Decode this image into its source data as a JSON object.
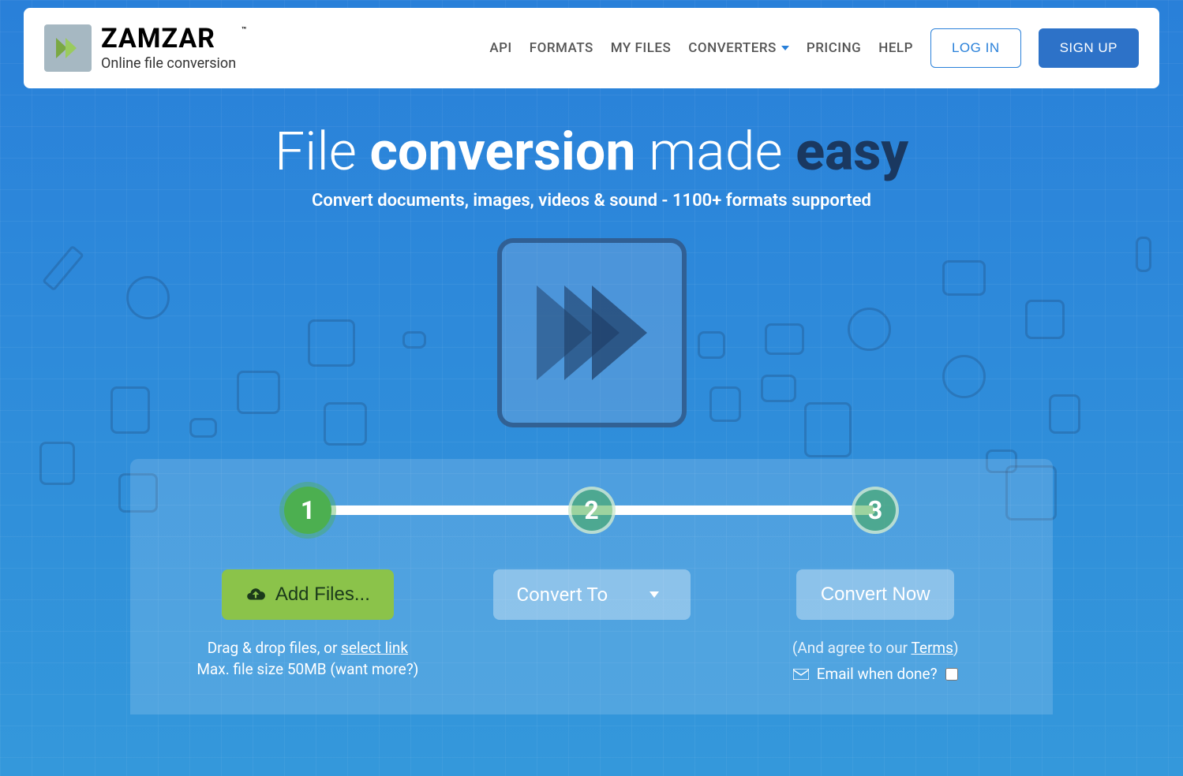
{
  "brand": {
    "name": "ZAMZAR",
    "tagline": "Online file conversion",
    "tm": "™"
  },
  "nav": {
    "api": "API",
    "formats": "FORMATS",
    "myfiles": "MY FILES",
    "converters": "CONVERTERS",
    "pricing": "PRICING",
    "help": "HELP",
    "login": "LOG IN",
    "signup": "SIGN UP"
  },
  "hero": {
    "t1": "File ",
    "t2": "conversion",
    "t3": " made ",
    "t4": "easy",
    "subtitle": "Convert documents, images, videos & sound - 1100+ formats supported"
  },
  "steps": {
    "s1": "1",
    "s2": "2",
    "s3": "3"
  },
  "panel": {
    "add_files": "Add Files...",
    "drag_prefix": "Drag & drop files, or ",
    "drag_link": "select link",
    "max_prefix": "Max. file size 50MB (",
    "max_link": "want more?",
    "max_suffix": ")",
    "convert_to": "Convert To",
    "convert_now": "Convert Now",
    "agree_prefix": "(And agree to our ",
    "agree_link": "Terms",
    "agree_suffix": ")",
    "email_label": "Email when done?"
  }
}
